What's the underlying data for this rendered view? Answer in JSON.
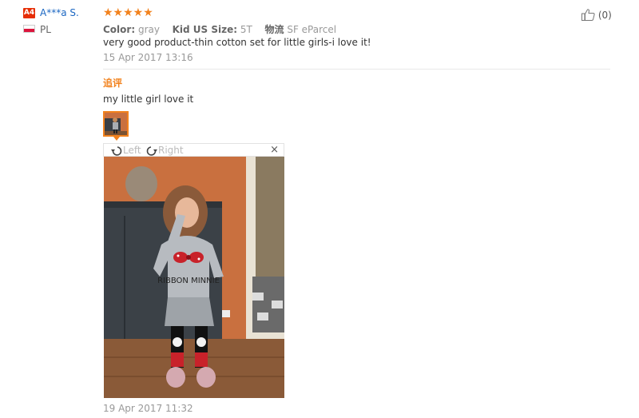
{
  "user": {
    "level_badge": "A4",
    "name": "A***a S.",
    "country": "PL",
    "flag_colors": [
      "#ffffff",
      "#dc143c"
    ]
  },
  "review": {
    "stars": "★★★★★",
    "attributes": [
      {
        "label": "Color:",
        "value": "gray"
      },
      {
        "label": "Kid US Size:",
        "value": "5T"
      },
      {
        "label": "物流",
        "value": "SF eParcel"
      }
    ],
    "text": "very good product-thin cotton set for little girls-i love it!",
    "date": "15 Apr 2017 13:16"
  },
  "followup": {
    "title": "追评",
    "text": "my little girl love it",
    "photo_date": "19 Apr 2017 11:32"
  },
  "viewer": {
    "rotate_left_label": "Left",
    "rotate_right_label": "Right",
    "close_symbol": "×",
    "photo_shirt_text": "RIBBON MINNIE"
  },
  "helpful": {
    "count_label": "(0)"
  },
  "colors": {
    "accent_orange": "#f2821d",
    "link_blue": "#1a66c2",
    "badge_red": "#e62e04"
  }
}
